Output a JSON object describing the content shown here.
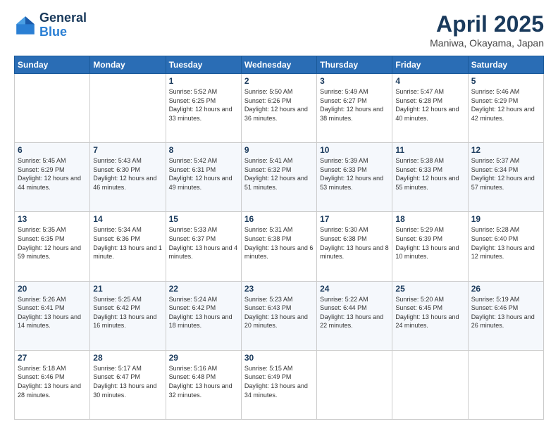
{
  "header": {
    "logo_general": "General",
    "logo_blue": "Blue",
    "month_title": "April 2025",
    "location": "Maniwa, Okayama, Japan"
  },
  "days_of_week": [
    "Sunday",
    "Monday",
    "Tuesday",
    "Wednesday",
    "Thursday",
    "Friday",
    "Saturday"
  ],
  "weeks": [
    [
      {
        "day": "",
        "content": ""
      },
      {
        "day": "",
        "content": ""
      },
      {
        "day": "1",
        "content": "Sunrise: 5:52 AM\nSunset: 6:25 PM\nDaylight: 12 hours and 33 minutes."
      },
      {
        "day": "2",
        "content": "Sunrise: 5:50 AM\nSunset: 6:26 PM\nDaylight: 12 hours and 36 minutes."
      },
      {
        "day": "3",
        "content": "Sunrise: 5:49 AM\nSunset: 6:27 PM\nDaylight: 12 hours and 38 minutes."
      },
      {
        "day": "4",
        "content": "Sunrise: 5:47 AM\nSunset: 6:28 PM\nDaylight: 12 hours and 40 minutes."
      },
      {
        "day": "5",
        "content": "Sunrise: 5:46 AM\nSunset: 6:29 PM\nDaylight: 12 hours and 42 minutes."
      }
    ],
    [
      {
        "day": "6",
        "content": "Sunrise: 5:45 AM\nSunset: 6:29 PM\nDaylight: 12 hours and 44 minutes."
      },
      {
        "day": "7",
        "content": "Sunrise: 5:43 AM\nSunset: 6:30 PM\nDaylight: 12 hours and 46 minutes."
      },
      {
        "day": "8",
        "content": "Sunrise: 5:42 AM\nSunset: 6:31 PM\nDaylight: 12 hours and 49 minutes."
      },
      {
        "day": "9",
        "content": "Sunrise: 5:41 AM\nSunset: 6:32 PM\nDaylight: 12 hours and 51 minutes."
      },
      {
        "day": "10",
        "content": "Sunrise: 5:39 AM\nSunset: 6:33 PM\nDaylight: 12 hours and 53 minutes."
      },
      {
        "day": "11",
        "content": "Sunrise: 5:38 AM\nSunset: 6:33 PM\nDaylight: 12 hours and 55 minutes."
      },
      {
        "day": "12",
        "content": "Sunrise: 5:37 AM\nSunset: 6:34 PM\nDaylight: 12 hours and 57 minutes."
      }
    ],
    [
      {
        "day": "13",
        "content": "Sunrise: 5:35 AM\nSunset: 6:35 PM\nDaylight: 12 hours and 59 minutes."
      },
      {
        "day": "14",
        "content": "Sunrise: 5:34 AM\nSunset: 6:36 PM\nDaylight: 13 hours and 1 minute."
      },
      {
        "day": "15",
        "content": "Sunrise: 5:33 AM\nSunset: 6:37 PM\nDaylight: 13 hours and 4 minutes."
      },
      {
        "day": "16",
        "content": "Sunrise: 5:31 AM\nSunset: 6:38 PM\nDaylight: 13 hours and 6 minutes."
      },
      {
        "day": "17",
        "content": "Sunrise: 5:30 AM\nSunset: 6:38 PM\nDaylight: 13 hours and 8 minutes."
      },
      {
        "day": "18",
        "content": "Sunrise: 5:29 AM\nSunset: 6:39 PM\nDaylight: 13 hours and 10 minutes."
      },
      {
        "day": "19",
        "content": "Sunrise: 5:28 AM\nSunset: 6:40 PM\nDaylight: 13 hours and 12 minutes."
      }
    ],
    [
      {
        "day": "20",
        "content": "Sunrise: 5:26 AM\nSunset: 6:41 PM\nDaylight: 13 hours and 14 minutes."
      },
      {
        "day": "21",
        "content": "Sunrise: 5:25 AM\nSunset: 6:42 PM\nDaylight: 13 hours and 16 minutes."
      },
      {
        "day": "22",
        "content": "Sunrise: 5:24 AM\nSunset: 6:42 PM\nDaylight: 13 hours and 18 minutes."
      },
      {
        "day": "23",
        "content": "Sunrise: 5:23 AM\nSunset: 6:43 PM\nDaylight: 13 hours and 20 minutes."
      },
      {
        "day": "24",
        "content": "Sunrise: 5:22 AM\nSunset: 6:44 PM\nDaylight: 13 hours and 22 minutes."
      },
      {
        "day": "25",
        "content": "Sunrise: 5:20 AM\nSunset: 6:45 PM\nDaylight: 13 hours and 24 minutes."
      },
      {
        "day": "26",
        "content": "Sunrise: 5:19 AM\nSunset: 6:46 PM\nDaylight: 13 hours and 26 minutes."
      }
    ],
    [
      {
        "day": "27",
        "content": "Sunrise: 5:18 AM\nSunset: 6:46 PM\nDaylight: 13 hours and 28 minutes."
      },
      {
        "day": "28",
        "content": "Sunrise: 5:17 AM\nSunset: 6:47 PM\nDaylight: 13 hours and 30 minutes."
      },
      {
        "day": "29",
        "content": "Sunrise: 5:16 AM\nSunset: 6:48 PM\nDaylight: 13 hours and 32 minutes."
      },
      {
        "day": "30",
        "content": "Sunrise: 5:15 AM\nSunset: 6:49 PM\nDaylight: 13 hours and 34 minutes."
      },
      {
        "day": "",
        "content": ""
      },
      {
        "day": "",
        "content": ""
      },
      {
        "day": "",
        "content": ""
      }
    ]
  ]
}
